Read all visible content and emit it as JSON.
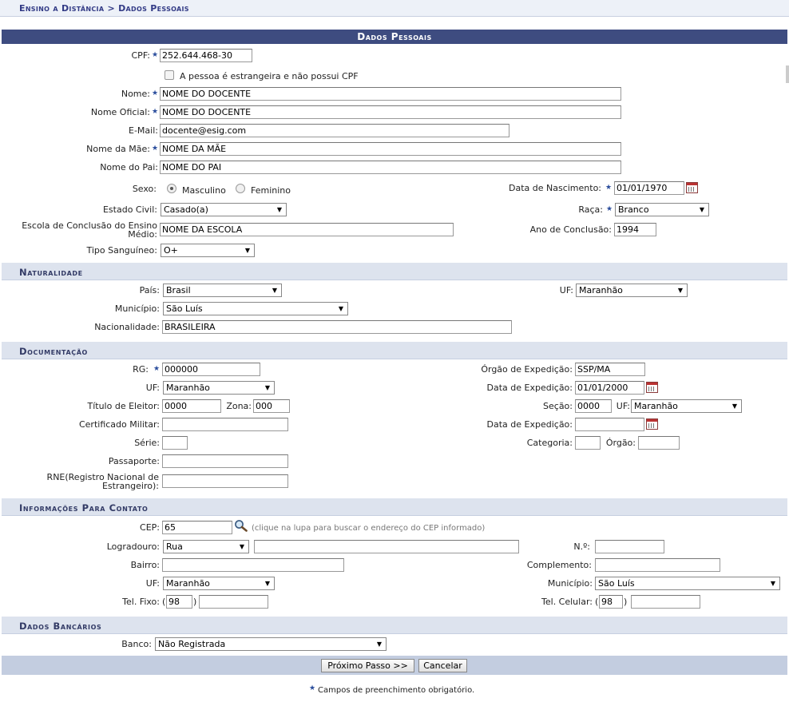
{
  "breadcrumb": "Ensino a Distância > Dados Pessoais",
  "title": "Dados Pessoais",
  "personal": {
    "cpf_label": "CPF:",
    "cpf": "252.644.468-30",
    "foreign_label": "A pessoa é estrangeira e não possui CPF",
    "nome_label": "Nome:",
    "nome": "NOME DO DOCENTE",
    "nome_oficial_label": "Nome Oficial:",
    "nome_oficial": "NOME DO DOCENTE",
    "email_label": "E-Mail:",
    "email": "docente@esig.com",
    "mae_label": "Nome da Mãe:",
    "mae": "NOME DA MÃE",
    "pai_label": "Nome do Pai:",
    "pai": "NOME DO PAI",
    "sexo_label": "Sexo:",
    "masculino": "Masculino",
    "feminino": "Feminino",
    "nascimento_label": "Data de Nascimento:",
    "nascimento": "01/01/1970",
    "estado_civil_label": "Estado Civil:",
    "estado_civil": "Casado(a)",
    "raca_label": "Raça:",
    "raca": "Branco",
    "escola_label": "Escola de Conclusão do Ensino Médio:",
    "escola": "NOME DA ESCOLA",
    "ano_label": "Ano de Conclusão:",
    "ano": "1994",
    "sangue_label": "Tipo Sanguíneo:",
    "sangue": "O+"
  },
  "naturalidade": {
    "header": "Naturalidade",
    "pais_label": "País:",
    "pais": "Brasil",
    "uf_label": "UF:",
    "uf": "Maranhão",
    "municipio_label": "Município:",
    "municipio": "São Luís",
    "nacionalidade_label": "Nacionalidade:",
    "nacionalidade": "BRASILEIRA"
  },
  "documentacao": {
    "header": "Documentação",
    "rg_label": "RG:",
    "rg": "000000",
    "orgao_label": "Órgão de Expedição:",
    "orgao": "SSP/MA",
    "uf_label": "UF:",
    "uf": "Maranhão",
    "data_exp_label": "Data de Expedição:",
    "data_exp": "01/01/2000",
    "titulo_label": "Título de Eleitor:",
    "titulo": "0000",
    "zona_label": "Zona:",
    "zona": "000",
    "secao_label": "Seção:",
    "secao": "0000",
    "uf2_label": "UF:",
    "uf2": "Maranhão",
    "cert_label": "Certificado Militar:",
    "data_exp2_label": "Data de Expedição:",
    "serie_label": "Série:",
    "categoria_label": "Categoria:",
    "orgao2_label": "Órgão:",
    "passaporte_label": "Passaporte:",
    "rne_label": "RNE(Registro Nacional de Estrangeiro):"
  },
  "contato": {
    "header": "Informações Para Contato",
    "cep_label": "CEP:",
    "cep": "65",
    "cep_hint": "(clique na lupa para buscar o endereço do CEP informado)",
    "logradouro_label": "Logradouro:",
    "logradouro_tipo": "Rua",
    "numero_label": "N.º:",
    "bairro_label": "Bairro:",
    "complemento_label": "Complemento:",
    "uf_label": "UF:",
    "uf": "Maranhão",
    "municipio_label": "Município:",
    "municipio": "São Luís",
    "fixo_label": "Tel. Fixo:",
    "fixo_ddd": "98",
    "celular_label": "Tel. Celular:",
    "celular_ddd": "98",
    "paren_open": "(",
    "paren_close": ")"
  },
  "bancarios": {
    "header": "Dados Bancários",
    "banco_label": "Banco:",
    "banco": "Não Registrada"
  },
  "buttons": {
    "next": "Próximo Passo >>",
    "cancel": "Cancelar"
  },
  "footer_note": "Campos de preenchimento obrigatório."
}
